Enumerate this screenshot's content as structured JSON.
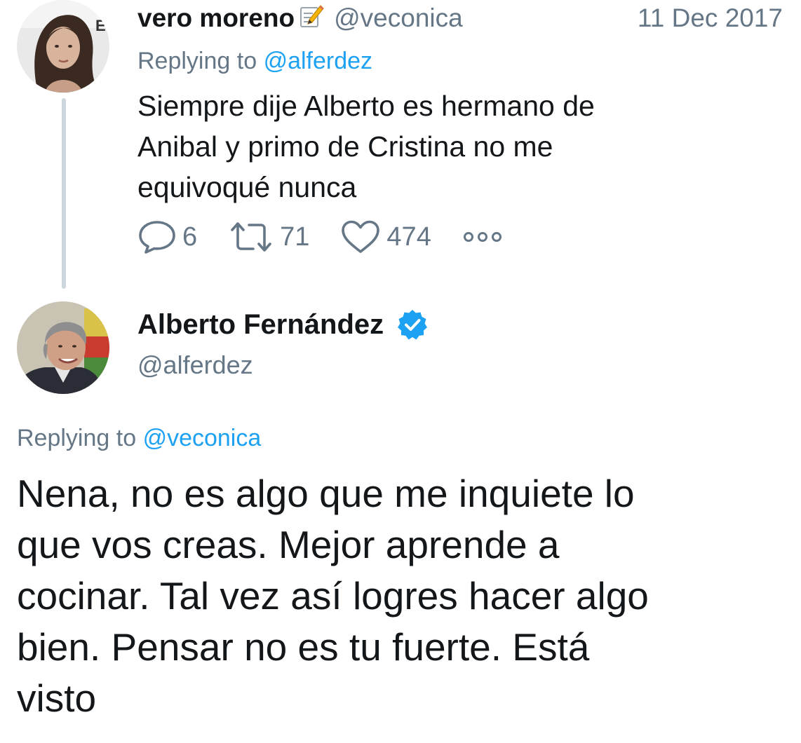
{
  "parent_tweet": {
    "author_name": "vero moreno",
    "author_name_emoji_icon": "memo-pencil-icon",
    "handle": "@veconica",
    "date": "11 Dec 2017",
    "replying_prefix": "Replying to",
    "replying_to": "@alferdez",
    "text_lines": [
      "Siempre dije Alberto es hermano de",
      "Anibal y primo de Cristina no me",
      "equivoqué nunca"
    ],
    "actions": {
      "reply_icon": "reply-bubble-icon",
      "reply_count": "6",
      "retweet_icon": "retweet-icon",
      "retweet_count": "71",
      "like_icon": "heart-icon",
      "like_count": "474",
      "more_icon": "more-dots-icon"
    }
  },
  "reply_tweet": {
    "author_name": "Alberto Fernández",
    "verified_icon": "verified-badge-icon",
    "handle": "@alferdez",
    "replying_prefix": "Replying to",
    "replying_to": "@veconica",
    "text_lines": [
      "Nena, no es algo que me inquiete lo",
      "que vos creas. Mejor aprende a",
      "cocinar. Tal vez así logres hacer algo",
      "bien. Pensar no es tu fuerte. Está",
      "visto"
    ]
  },
  "colors": {
    "text_primary": "#14171a",
    "text_secondary": "#657786",
    "link_blue": "#1da1f2",
    "verified_blue": "#1da1f2",
    "thread_line": "#ccd6dd"
  }
}
